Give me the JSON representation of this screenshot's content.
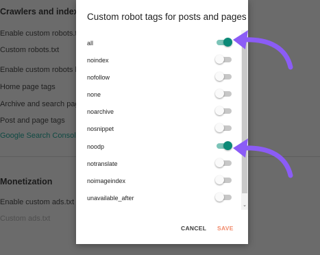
{
  "background_page": {
    "section_heading": "Crawlers and indexing",
    "items": [
      "Enable custom robots.txt",
      "Custom robots.txt",
      "Enable custom robots header tags",
      "Home page tags",
      "Archive and search page tags",
      "Post and page tags",
      "Google Search Console"
    ],
    "monetization_heading": "Monetization",
    "monetization_items": [
      "Enable custom ads.txt",
      "Custom ads.txt"
    ]
  },
  "dialog": {
    "title": "Custom robot tags for posts and pages",
    "options": [
      {
        "label": "all",
        "enabled": true
      },
      {
        "label": "noindex",
        "enabled": false
      },
      {
        "label": "nofollow",
        "enabled": false
      },
      {
        "label": "none",
        "enabled": false
      },
      {
        "label": "noarchive",
        "enabled": false
      },
      {
        "label": "nosnippet",
        "enabled": false
      },
      {
        "label": "noodp",
        "enabled": true
      },
      {
        "label": "notranslate",
        "enabled": false
      },
      {
        "label": "noimageindex",
        "enabled": false
      },
      {
        "label": "unavailable_after",
        "enabled": false
      }
    ],
    "cancel_label": "CANCEL",
    "save_label": "SAVE"
  },
  "colors": {
    "accent_teal": "#0b8a77",
    "save_orange": "#f18a6b",
    "annotation_purple": "#8b5cf6"
  },
  "icons": {
    "scroll_down": "chevron-down-icon",
    "annotation": "curved-arrow-icon"
  }
}
